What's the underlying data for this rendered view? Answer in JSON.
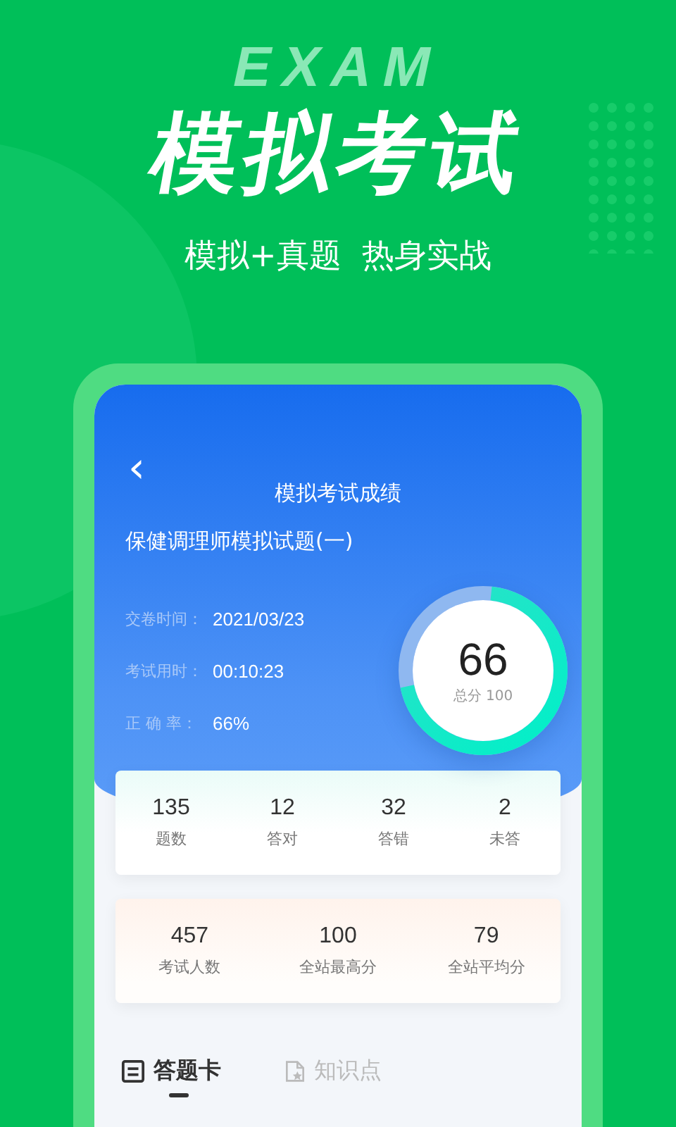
{
  "banner": {
    "background_word": "EXAM",
    "headline": "模拟考试",
    "tagline": "模拟+真题  热身实战"
  },
  "screen": {
    "nav": {
      "back": "‹",
      "title": "模拟考试成绩"
    },
    "exam_name": "保健调理师模拟试题(一)",
    "info": [
      {
        "label": "交卷时间：",
        "value": "2021/03/23"
      },
      {
        "label": "考试用时：",
        "value": "00:10:23"
      },
      {
        "label": "正 确 率：",
        "value": "66%"
      }
    ],
    "score": {
      "value": "66",
      "caption": "总分 100",
      "level": 0.7
    },
    "answer_stats": [
      {
        "value": "135",
        "label": "题数"
      },
      {
        "value": "12",
        "label": "答对"
      },
      {
        "value": "32",
        "label": "答错"
      },
      {
        "value": "2",
        "label": "未答"
      }
    ],
    "site_stats": [
      {
        "value": "457",
        "label": "考试人数"
      },
      {
        "value": "100",
        "label": "全站最高分"
      },
      {
        "value": "79",
        "label": "全站平均分"
      }
    ],
    "tabs": [
      {
        "label": "答题卡",
        "kind": "card",
        "selected": true
      },
      {
        "label": "知识点",
        "kind": "doc",
        "selected": false
      }
    ]
  }
}
